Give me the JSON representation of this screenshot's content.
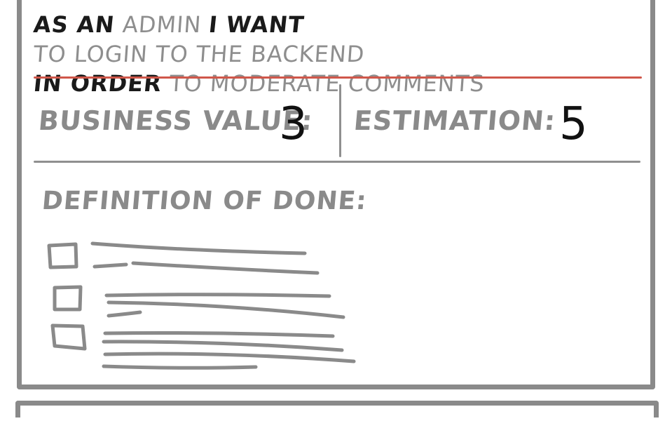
{
  "story": {
    "part1": "AS AN",
    "part2": "ADMIN",
    "part3": "I WANT",
    "part4": "TO LOGIN TO THE BACKEND",
    "part5": "IN ORDER",
    "part6": "TO MODERATE COMMENTS"
  },
  "fields": {
    "business_value_label": "BUSINESS VALUE:",
    "business_value": "3",
    "estimation_label": "ESTIMATION:",
    "estimation": "5",
    "definition_of_done_label": "DEFINITION OF DONE:"
  },
  "checklist": {
    "item_count": 3
  },
  "colors": {
    "frame": "#8a8a8a",
    "accent_line": "#d0574a",
    "ink": "#1a1a1a",
    "pencil": "#8e8e8e"
  }
}
